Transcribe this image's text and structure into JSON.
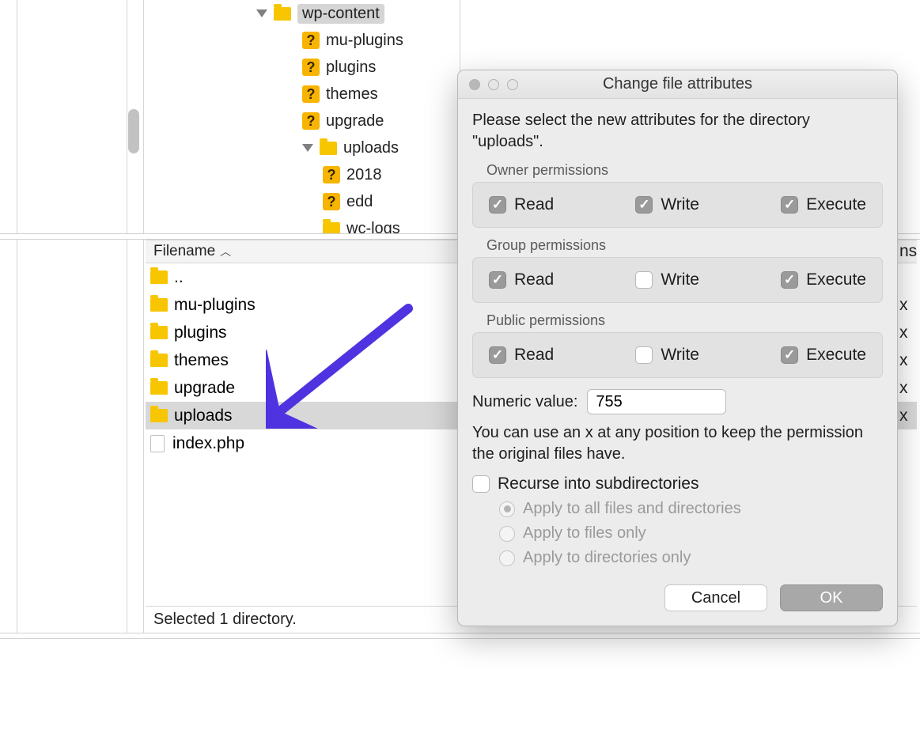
{
  "tree": {
    "items": [
      {
        "kind": "folder",
        "label": "wp-content",
        "selected": true,
        "indent": 0,
        "expander": true
      },
      {
        "kind": "q",
        "label": "mu-plugins",
        "indent": 1
      },
      {
        "kind": "q",
        "label": "plugins",
        "indent": 1
      },
      {
        "kind": "q",
        "label": "themes",
        "indent": 1
      },
      {
        "kind": "q",
        "label": "upgrade",
        "indent": 1
      },
      {
        "kind": "folder",
        "label": "uploads",
        "indent": 1,
        "expander": true
      },
      {
        "kind": "q",
        "label": "2018",
        "indent": 2
      },
      {
        "kind": "q",
        "label": "edd",
        "indent": 2
      },
      {
        "kind": "folder",
        "label": "wc-logs",
        "indent": 2
      }
    ]
  },
  "list": {
    "header": "Filename",
    "right_header_char": "ns",
    "rows": [
      {
        "kind": "folder",
        "label": "..",
        "x": ""
      },
      {
        "kind": "folder",
        "label": "mu-plugins",
        "x": "x"
      },
      {
        "kind": "folder",
        "label": "plugins",
        "x": "x"
      },
      {
        "kind": "folder",
        "label": "themes",
        "x": "x"
      },
      {
        "kind": "folder",
        "label": "upgrade",
        "x": "x"
      },
      {
        "kind": "folder",
        "label": "uploads",
        "selected": true,
        "x": "x"
      },
      {
        "kind": "file",
        "label": "index.php",
        "x": ""
      }
    ],
    "status": "Selected 1 directory."
  },
  "dialog": {
    "title": "Change file attributes",
    "instruction": "Please select the new attributes for the directory \"uploads\".",
    "groups": [
      {
        "label": "Owner permissions",
        "read": true,
        "write": true,
        "execute": true
      },
      {
        "label": "Group permissions",
        "read": true,
        "write": false,
        "execute": true
      },
      {
        "label": "Public permissions",
        "read": true,
        "write": false,
        "execute": true
      }
    ],
    "perm_labels": {
      "read": "Read",
      "write": "Write",
      "execute": "Execute"
    },
    "numeric_label": "Numeric value:",
    "numeric_value": "755",
    "hint": "You can use an x at any position to keep the permission the original files have.",
    "recurse_label": "Recurse into subdirectories",
    "recurse_checked": false,
    "radios": [
      {
        "label": "Apply to all files and directories",
        "selected": true
      },
      {
        "label": "Apply to files only",
        "selected": false
      },
      {
        "label": "Apply to directories only",
        "selected": false
      }
    ],
    "cancel": "Cancel",
    "ok": "OK"
  },
  "colors": {
    "arrow": "#5033e0"
  }
}
